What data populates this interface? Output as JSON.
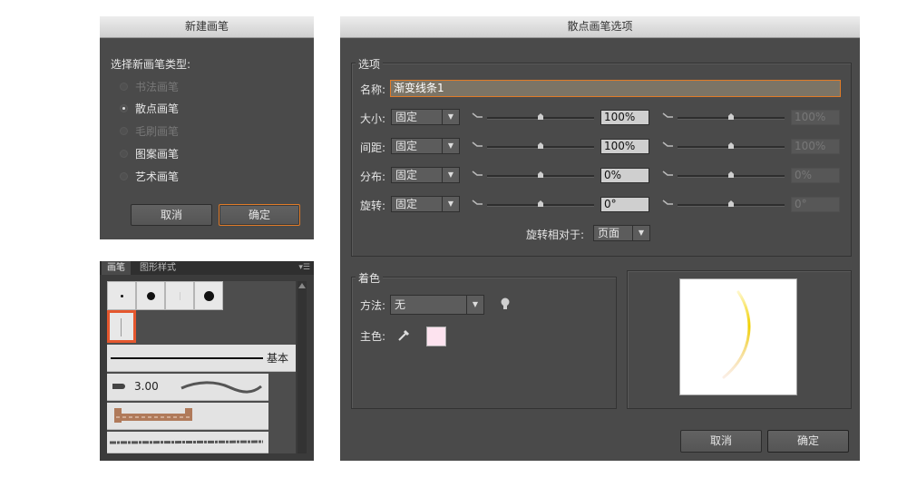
{
  "new_brush_dialog": {
    "title": "新建画笔",
    "prompt": "选择新画笔类型:",
    "options": [
      {
        "label": "书法画笔",
        "state": "disabled"
      },
      {
        "label": "散点画笔",
        "state": "selected"
      },
      {
        "label": "毛刷画笔",
        "state": "disabled"
      },
      {
        "label": "图案画笔",
        "state": "normal"
      },
      {
        "label": "艺术画笔",
        "state": "normal"
      }
    ],
    "cancel_label": "取消",
    "ok_label": "确定"
  },
  "brushes_panel": {
    "tabs": [
      "画笔",
      "图形样式"
    ],
    "basic_label": "基本",
    "stroke_weight": "3.00"
  },
  "scatter_dialog": {
    "title": "散点画笔选项",
    "options_group": "选项",
    "name_label": "名称:",
    "name_value": "渐变线条1",
    "rows": [
      {
        "label": "大小:",
        "method": "固定",
        "value": "100%",
        "value2": "100%"
      },
      {
        "label": "间距:",
        "method": "固定",
        "value": "100%",
        "value2": "100%"
      },
      {
        "label": "分布:",
        "method": "固定",
        "value": "0%",
        "value2": "0%"
      },
      {
        "label": "旋转:",
        "method": "固定",
        "value": "0°",
        "value2": "0°"
      }
    ],
    "rotation_relative_label": "旋转相对于:",
    "rotation_relative_value": "页面",
    "colorization_group": "着色",
    "method_label": "方法:",
    "method_value": "无",
    "key_color_label": "主色:",
    "cancel_label": "取消",
    "ok_label": "确定",
    "colors": {
      "accent": "#e07b28",
      "key_color": "#fde3ef",
      "dialog_bg": "#4a4a4a"
    }
  }
}
